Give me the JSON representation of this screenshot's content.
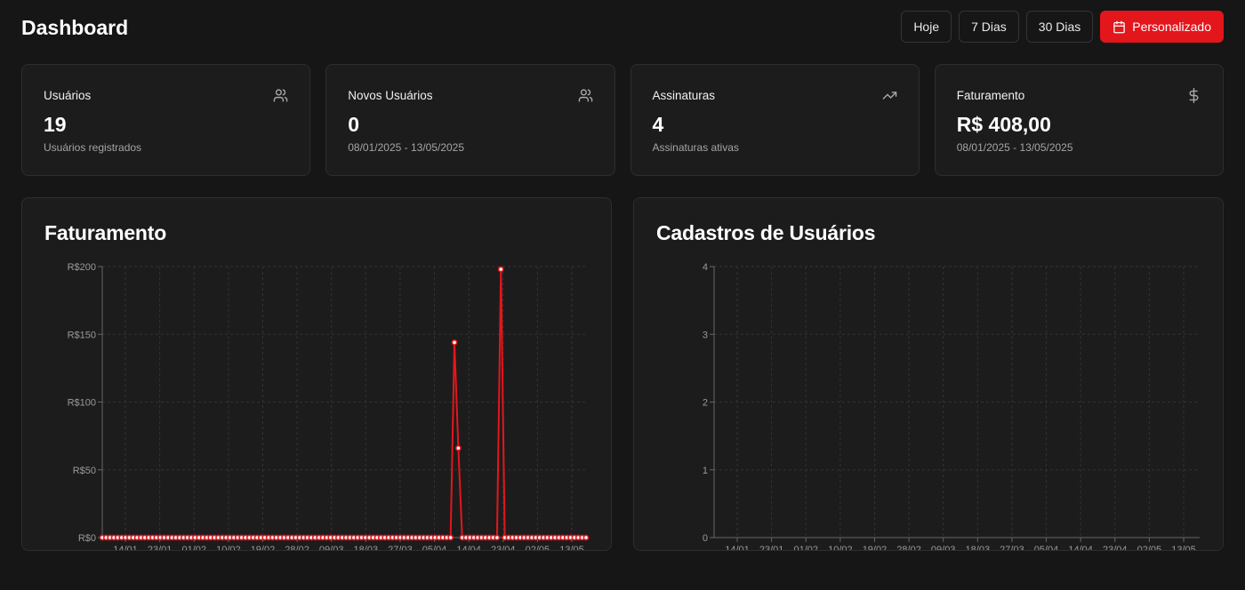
{
  "header": {
    "title": "Dashboard",
    "ranges": [
      {
        "label": "Hoje",
        "active": false
      },
      {
        "label": "7 Dias",
        "active": false
      },
      {
        "label": "30 Dias",
        "active": false
      },
      {
        "label": "Personalizado",
        "active": true,
        "icon": "calendar-icon"
      }
    ]
  },
  "cards": [
    {
      "label": "Usuários",
      "icon": "users-icon",
      "value": "19",
      "sub": "Usuários registrados"
    },
    {
      "label": "Novos Usuários",
      "icon": "users-icon",
      "value": "0",
      "sub": "08/01/2025 - 13/05/2025"
    },
    {
      "label": "Assinaturas",
      "icon": "trending-up-icon",
      "value": "4",
      "sub": "Assinaturas ativas"
    },
    {
      "label": "Faturamento",
      "icon": "dollar-icon",
      "value": "R$ 408,00",
      "sub": "08/01/2025 - 13/05/2025"
    }
  ],
  "colors": {
    "accent": "#e3161c",
    "background": "#161616",
    "card": "#1c1c1c",
    "border": "#2e2e2e"
  },
  "chart_data": [
    {
      "type": "line",
      "title": "Faturamento",
      "x_start": "08/01/2025",
      "x_end": "13/05/2025",
      "tick_labels": [
        "14/01",
        "23/01",
        "01/02",
        "10/02",
        "19/02",
        "28/02",
        "09/03",
        "18/03",
        "27/03",
        "05/04",
        "14/04",
        "23/04",
        "02/05",
        "13/05"
      ],
      "y_ticks": [
        "R$0",
        "R$50",
        "R$100",
        "R$150",
        "R$200"
      ],
      "ylim": [
        0,
        200
      ],
      "nonzero_points": [
        {
          "x": "09/04/2025",
          "y": 144
        },
        {
          "x": "10/04/2025",
          "y": 66
        },
        {
          "x": "21/04/2025",
          "y": 198
        }
      ],
      "default_value": 0,
      "grid": true,
      "color": "#e3161c"
    },
    {
      "type": "line",
      "title": "Cadastros de Usuários",
      "tick_labels": [
        "14/01",
        "23/01",
        "01/02",
        "10/02",
        "19/02",
        "28/02",
        "09/03",
        "18/03",
        "27/03",
        "05/04",
        "14/04",
        "23/04",
        "02/05",
        "13/05"
      ],
      "y_ticks": [
        "0",
        "1",
        "2",
        "3",
        "4"
      ],
      "ylim": [
        0,
        4
      ],
      "grid": true
    }
  ]
}
